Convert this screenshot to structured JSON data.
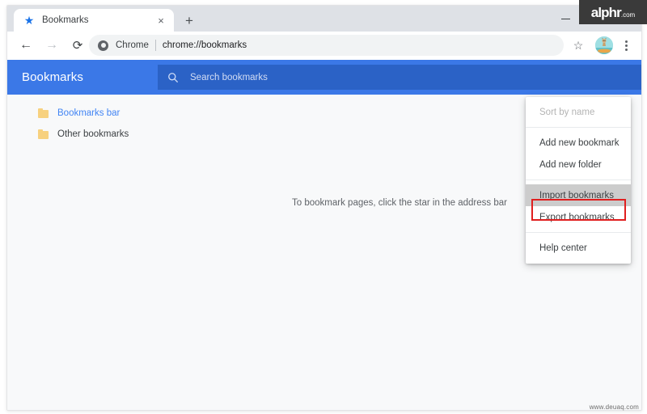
{
  "window": {
    "minimize_label": "minimize",
    "watermark_brand": "alphr",
    "watermark_brand_suffix": ".com",
    "watermark_footer": "www.deuaq.com"
  },
  "tabs": [
    {
      "title": "Bookmarks",
      "favicon": "star-icon",
      "close_label": "×"
    }
  ],
  "new_tab": {
    "label": "+"
  },
  "toolbar": {
    "back_label": "←",
    "forward_label": "→",
    "reload_label": "⟳",
    "omnibox": {
      "scheme_label": "Chrome",
      "url": "chrome://bookmarks"
    },
    "star_label": "☆",
    "menu_label": "⋮"
  },
  "bookmarks_page": {
    "header_title": "Bookmarks",
    "search": {
      "placeholder": "Search bookmarks",
      "value": ""
    },
    "sidebar": {
      "items": [
        {
          "label": "Bookmarks bar",
          "selected": true
        },
        {
          "label": "Other bookmarks",
          "selected": false
        }
      ]
    },
    "empty_state_text": "To bookmark pages, click the star in the address bar"
  },
  "dropdown_menu": {
    "items": [
      {
        "label": "Sort by name",
        "state": "disabled"
      },
      {
        "label": "Add new bookmark",
        "state": "normal"
      },
      {
        "label": "Add new folder",
        "state": "normal"
      },
      {
        "label": "Import bookmarks",
        "state": "highlighted"
      },
      {
        "label": "Export bookmarks",
        "state": "normal"
      },
      {
        "label": "Help center",
        "state": "normal"
      }
    ]
  },
  "colors": {
    "chrome_blue": "#3b78e7",
    "search_field_blue": "#2b62c6",
    "accent_link": "#4285f4",
    "folder_yellow": "#f7d17f",
    "annotation_red": "#e01f1f",
    "menu_highlight_grey": "#cccccc",
    "tabstrip_grey": "#dee1e6",
    "page_background": "#f8f9fa"
  }
}
